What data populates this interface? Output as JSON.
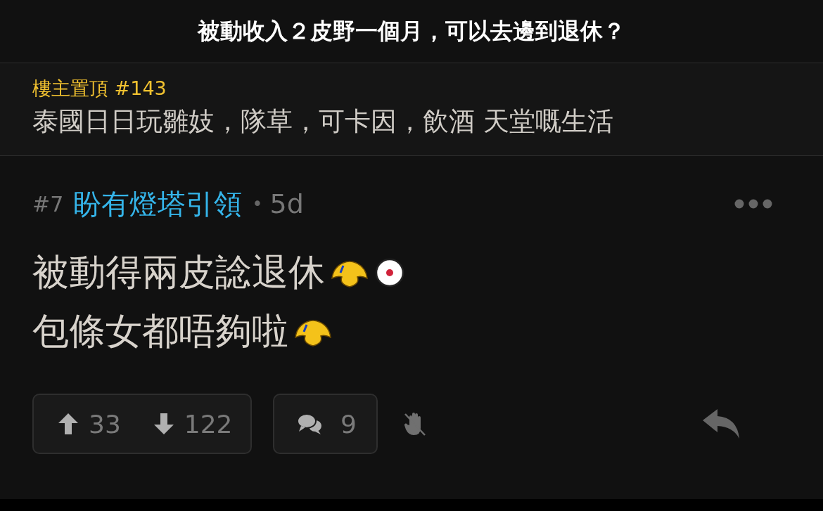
{
  "thread_title": "被動收入２皮野一個月，可以去邊到退休？",
  "pinned": {
    "label": "樓主置頂 #143",
    "text": "泰國日日玩雛妓，隊草，可卡因，飲酒 天堂嘅生活"
  },
  "post": {
    "number": "#7",
    "author": "盼有燈塔引領",
    "separator": "•",
    "age": "5d",
    "lines": [
      {
        "text": "被動得兩皮諗退休",
        "emojis": [
          {
            "kind": "yellow"
          },
          {
            "kind": "white"
          }
        ]
      },
      {
        "text": "包條女都唔夠啦",
        "emojis": [
          {
            "kind": "yellow"
          }
        ]
      }
    ],
    "upvotes": "33",
    "downvotes": "122",
    "replies": "9"
  }
}
